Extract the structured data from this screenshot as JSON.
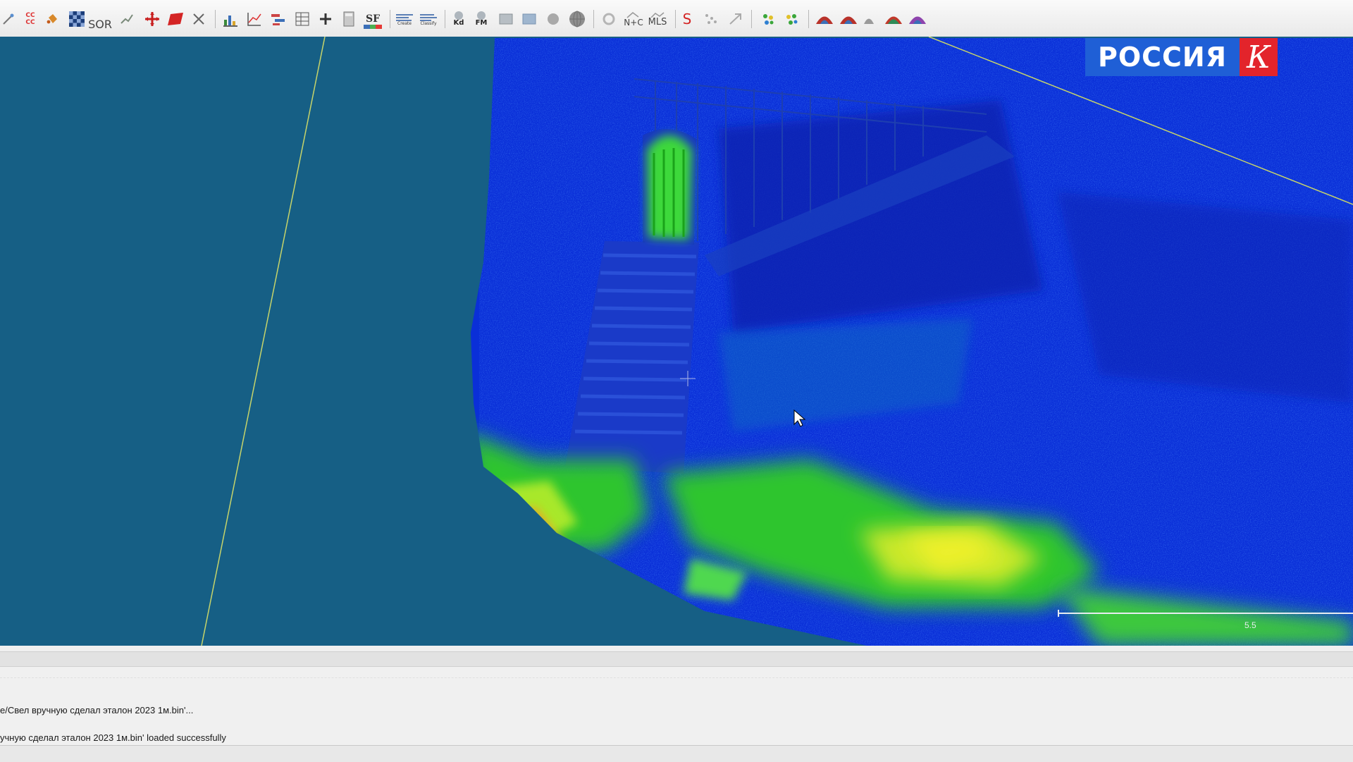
{
  "app": {
    "toolbar": {
      "items": [
        {
          "icon": "point-list-picking-icon"
        },
        {
          "icon": "cloud-compare-icon",
          "text": "CC CC"
        },
        {
          "icon": "bucket-fill-icon"
        },
        {
          "icon": "checkerboard-icon"
        },
        {
          "icon": "sor-filter-icon",
          "text": "SOR"
        },
        {
          "icon": "trace-polyline-icon"
        },
        {
          "icon": "translate-rotate-icon"
        },
        {
          "icon": "fit-plane-icon"
        },
        {
          "icon": "scissors-icon"
        },
        {
          "icon": "histogram-icon"
        },
        {
          "icon": "plot-graph-icon"
        },
        {
          "icon": "ransac-icon"
        },
        {
          "icon": "table-icon"
        },
        {
          "icon": "add-point-icon"
        },
        {
          "icon": "calculator-icon"
        },
        {
          "icon": "scalar-field-icon",
          "text": "SF"
        },
        {
          "icon": "canupo-create-icon",
          "text": "Create"
        },
        {
          "icon": "canupo-classify-icon",
          "text": "Classify"
        },
        {
          "icon": "kd-tree-icon",
          "text": "Kd"
        },
        {
          "icon": "facet-icon",
          "text": "FM"
        },
        {
          "icon": "sphere-fit-icon"
        },
        {
          "icon": "mesh-icon"
        },
        {
          "icon": "ball-icon"
        },
        {
          "icon": "globe-icon"
        },
        {
          "icon": "animation-icon"
        },
        {
          "icon": "normal-compute-icon",
          "text": "N+C"
        },
        {
          "icon": "mls-smoothing-icon",
          "text": "MLS"
        },
        {
          "icon": "s-curve-icon",
          "text": "S"
        },
        {
          "icon": "scatter-icon"
        },
        {
          "icon": "register-icon"
        },
        {
          "icon": "color-cloud-icon"
        },
        {
          "icon": "color-cloud-2-icon"
        },
        {
          "icon": "qanimation-icon"
        },
        {
          "icon": "qhidden-point-icon"
        },
        {
          "icon": "cloud-small-icon"
        },
        {
          "icon": "qpcv-icon"
        },
        {
          "icon": "qcsf-icon"
        }
      ]
    },
    "channel_logo": {
      "text": "РОССИЯ",
      "letter": "К",
      "colors": {
        "blue": "#1f5fd6",
        "red": "#e3242b"
      }
    },
    "viewport": {
      "background": "#165f85",
      "scale_label": "5.5",
      "scale_fields": [
        "blue",
        "green",
        "yellow",
        "red"
      ]
    },
    "console": {
      "lines": [
        "e/Свел вручную сделал эталон 2023 1м.bin'...",
        "учную сделал эталон 2023 1м.bin' loaded successfully"
      ]
    }
  }
}
